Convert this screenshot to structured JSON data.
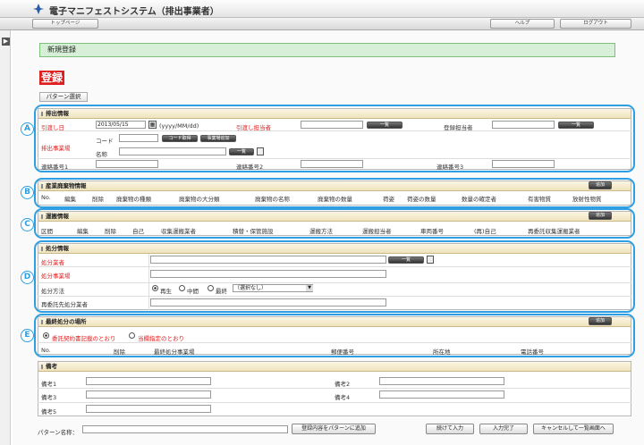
{
  "app": {
    "title": "電子マニフェストシステム（排出事業者）"
  },
  "nav": {
    "top_page": "トップページ",
    "help": "ヘルプ",
    "logout": "ログアウト"
  },
  "page": {
    "header": "新規登録",
    "heading": "登録",
    "pattern_tab": "パターン選択"
  },
  "markers": {
    "a": "A",
    "b": "B",
    "c": "C",
    "d": "D",
    "e": "E"
  },
  "discharge": {
    "title": "排出情報",
    "delivery_date_label": "引渡し日",
    "delivery_date_value": "2013/05/15",
    "date_format": "(yyyy/MM/dd)",
    "handover_person_label": "引渡し担当者",
    "list_label": "一覧",
    "registrant_label": "登録担当者",
    "site_label": "排出事業場",
    "code_label": "コード",
    "code_get": "コード取得",
    "site_add": "事業場追加",
    "name_label": "名称",
    "contact1": "連絡番号1",
    "contact2": "連絡番号2",
    "contact3": "連絡番号3"
  },
  "waste": {
    "title": "産業廃棄物情報",
    "add": "追加",
    "columns": [
      "No.",
      "編集",
      "削除",
      "廃棄物の種類",
      "廃棄物の大分類",
      "廃棄物の名称",
      "廃棄物の数量",
      "荷姿",
      "荷姿の数量",
      "数量の確定者",
      "有害物質",
      "放射性物質"
    ]
  },
  "transport": {
    "title": "運搬情報",
    "add": "追加",
    "columns": [
      "区間",
      "編集",
      "削除",
      "自己",
      "収集運搬業者",
      "積替・保管施設",
      "運搬方法",
      "運搬担当者",
      "車両番号",
      "(再)自己",
      "再委託収集運搬業者"
    ]
  },
  "disposal": {
    "title": "処分情報",
    "operator_label": "処分業者",
    "list_label": "一覧",
    "site_label": "処分事業場",
    "method_label": "処分方法",
    "opt_recycle": "再生",
    "opt_intermediate": "中間",
    "opt_final": "最終",
    "select_value": "（選択なし）",
    "reconsign_label": "再委託先処分業者"
  },
  "final": {
    "title": "最終処分の場所",
    "add": "追加",
    "opt1": "委託契約書記載のとおり",
    "opt2": "当欄指定のとおり",
    "columns": [
      "No.",
      "削除",
      "最終処分事業場",
      "郵便番号",
      "所在地",
      "電話番号"
    ]
  },
  "remarks": {
    "title": "備考",
    "r1": "備考1",
    "r2": "備考2",
    "r3": "備考3",
    "r4": "備考4",
    "r5": "備考5"
  },
  "footer": {
    "pattern_name": "パターン名称：",
    "pattern_save": "登録内容をパターンに追加",
    "continue": "続けて入力",
    "complete": "入力完了",
    "cancel": "キャンセルして一覧画面へ"
  }
}
